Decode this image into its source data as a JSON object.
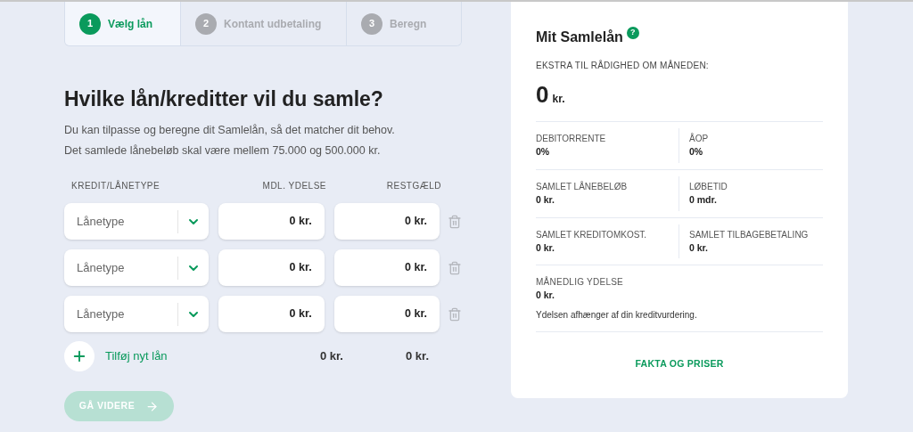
{
  "steps": [
    {
      "number": "1",
      "label": "Vælg lån",
      "selected": true
    },
    {
      "number": "2",
      "label": "Kontant udbetaling",
      "selected": false
    },
    {
      "number": "3",
      "label": "Beregn",
      "selected": false
    }
  ],
  "heading": "Hvilke lån/kreditter vil du samle?",
  "intro": [
    "Du kan tilpasse og beregne dit Samlelån, så det matcher dit behov.",
    "Det samlede lånebeløb skal være mellem 75.000 og 500.000 kr."
  ],
  "table": {
    "columns": [
      "KREDIT/LÅNETYPE",
      "MDL. YDELSE",
      "RESTGÆLD"
    ],
    "rows": [
      {
        "loan_type": {
          "placeholder": "Lånetype"
        },
        "monthly": "0 kr.",
        "debt": "0 kr."
      },
      {
        "loan_type": {
          "placeholder": "Lånetype"
        },
        "monthly": "0 kr.",
        "debt": "0 kr."
      },
      {
        "loan_type": {
          "placeholder": "Lånetype"
        },
        "monthly": "0 kr.",
        "debt": "0 kr."
      }
    ],
    "add_label": "Tilføj nyt lån",
    "total_monthly": "0 kr.",
    "total_debt": "0 kr."
  },
  "next_button": {
    "label": "GÅ VIDERE",
    "disabled": true
  },
  "summary": {
    "title": "Mit Samlelån",
    "help": "?",
    "extra_label": "EKSTRA TIL RÅDIGHED OM MÅNEDEN:",
    "extra_value": "0",
    "extra_unit": "kr.",
    "pairs": [
      [
        {
          "label": "DEBITORRENTE",
          "value": "0%"
        },
        {
          "label": "ÅOP",
          "value": "0%"
        }
      ],
      [
        {
          "label": "SAMLET LÅNEBELØB",
          "value": "0 kr."
        },
        {
          "label": "LØBETID",
          "value": "0 mdr."
        }
      ],
      [
        {
          "label": "SAMLET KREDITOMKOST.",
          "value": "0 kr."
        },
        {
          "label": "SAMLET TILBAGEBETALING",
          "value": "0 kr."
        }
      ]
    ],
    "monthly_label": "MÅNEDLIG YDELSE",
    "monthly_value": "0 kr.",
    "note": "Ydelsen afhænger af din kreditvurdering.",
    "link": "FAKTA OG PRISER"
  }
}
